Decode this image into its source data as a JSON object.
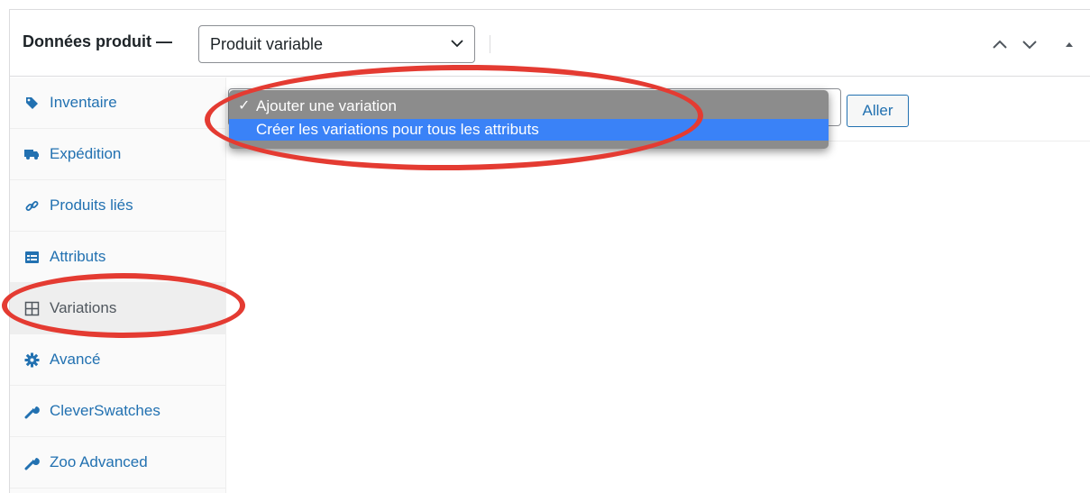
{
  "header": {
    "title": "Données produit —",
    "product_type": {
      "selected": "Produit variable"
    }
  },
  "sidebar": {
    "items": [
      {
        "label": "Inventaire",
        "icon": "tag-icon",
        "active": false
      },
      {
        "label": "Expédition",
        "icon": "truck-icon",
        "active": false
      },
      {
        "label": "Produits liés",
        "icon": "link-icon",
        "active": false
      },
      {
        "label": "Attributs",
        "icon": "list-view-icon",
        "active": false
      },
      {
        "label": "Variations",
        "icon": "grid-icon",
        "active": true
      },
      {
        "label": "Avancé",
        "icon": "gear-icon",
        "active": false
      },
      {
        "label": "CleverSwatches",
        "icon": "wrench-icon",
        "active": false
      },
      {
        "label": "Zoo Advanced",
        "icon": "wrench-icon",
        "active": false
      }
    ]
  },
  "variations": {
    "bulk_action_dropdown": {
      "options": [
        {
          "label": "Ajouter une variation",
          "checked": true,
          "highlighted": false
        },
        {
          "label": "Créer les variations pour tous les attributs",
          "checked": false,
          "highlighted": true
        }
      ]
    },
    "go_button": "Aller"
  },
  "colors": {
    "link": "#2271b1",
    "annotation": "#e43b32",
    "dropdown_bg": "#8c8c8c",
    "dropdown_highlight": "#3a82f7"
  }
}
